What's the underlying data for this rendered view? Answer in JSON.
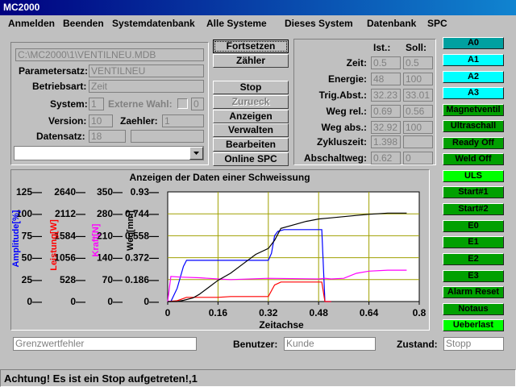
{
  "window": {
    "title": "MC2000"
  },
  "menu": [
    "Anmelden",
    "Beenden",
    "Systemdatenbank",
    "Alle Systeme",
    "Dieses System",
    "Datenbank",
    "SPC"
  ],
  "fileinfo": {
    "path": "C:\\MC2000\\1\\VENTILNEU.MDB",
    "parametersatz_label": "Parametersatz:",
    "parametersatz": "VENTILNEU",
    "betriebsart_label": "Betriebsart:",
    "betriebsart": "Zeit",
    "system_label": "System:",
    "system": "1",
    "extern_label": "Externe Wahl:",
    "extern_value": "0",
    "version_label": "Version:",
    "version": "10",
    "zaehler_label": "Zaehler:",
    "zaehler": "1",
    "datensatz_label": "Datensatz:",
    "datensatz": "18",
    "datensatz2": "",
    "combo": ""
  },
  "actions": {
    "fortsetzen": "Fortsetzen",
    "zaehler": "Zähler",
    "stop": "Stop",
    "zurueck": "Zurueck",
    "anzeigen": "Anzeigen",
    "verwalten": "Verwalten",
    "bearbeiten": "Bearbeiten",
    "online_spc": "Online SPC"
  },
  "values": {
    "ist_header": "Ist.:",
    "soll_header": "Soll:",
    "rows": [
      {
        "label": "Zeit:",
        "ist": "0.5",
        "soll": "0.5"
      },
      {
        "label": "Energie:",
        "ist": "48",
        "soll": "100"
      },
      {
        "label": "Trig.Abst.:",
        "ist": "32.23",
        "soll": "33.01"
      },
      {
        "label": "Weg rel.:",
        "ist": "0.69",
        "soll": "0.56"
      },
      {
        "label": "Weg abs.:",
        "ist": "32.92",
        "soll": "100"
      },
      {
        "label": "Zykluszeit:",
        "ist": "1.398",
        "soll": ""
      },
      {
        "label": "Abschaltweg:",
        "ist": "0.62",
        "soll": "0"
      }
    ]
  },
  "side_buttons": [
    {
      "label": "A0",
      "bg": "#00a0a0",
      "color": "#000000"
    },
    {
      "label": "A1",
      "bg": "#00ffff",
      "color": "#000000"
    },
    {
      "label": "A2",
      "bg": "#00ffff",
      "color": "#000000"
    },
    {
      "label": "A3",
      "bg": "#00ffff",
      "color": "#000000"
    },
    {
      "label": "Magnetventil",
      "bg": "#00a000",
      "color": "#000000"
    },
    {
      "label": "Ultraschall",
      "bg": "#00a000",
      "color": "#000000"
    },
    {
      "label": "Ready Off",
      "bg": "#00a000",
      "color": "#000000"
    },
    {
      "label": "Weld Off",
      "bg": "#00a000",
      "color": "#000000"
    },
    {
      "label": "ULS",
      "bg": "#00ff00",
      "color": "#000000"
    },
    {
      "label": "Start#1",
      "bg": "#00a000",
      "color": "#000000"
    },
    {
      "label": "Start#2",
      "bg": "#00a000",
      "color": "#000000"
    },
    {
      "label": "E0",
      "bg": "#00a000",
      "color": "#000000"
    },
    {
      "label": "E1",
      "bg": "#00a000",
      "color": "#000000"
    },
    {
      "label": "E2",
      "bg": "#00a000",
      "color": "#000000"
    },
    {
      "label": "E3",
      "bg": "#00a000",
      "color": "#000000"
    },
    {
      "label": "Alarm Reset",
      "bg": "#00a000",
      "color": "#000000"
    },
    {
      "label": "Notaus",
      "bg": "#00a000",
      "color": "#000000"
    },
    {
      "label": "Ueberlast",
      "bg": "#00ff00",
      "color": "#000000"
    }
  ],
  "chart_data": {
    "type": "line",
    "title": "Anzeigen der Daten einer Schweissung",
    "xlabel": "Zeitachse",
    "xlim": [
      0,
      0.8
    ],
    "xticks": [
      "0",
      "0.16",
      "0.32",
      "0.48",
      "0.64",
      "0.8"
    ],
    "grid": true,
    "axes": [
      {
        "label": "Amplitude[%]",
        "color": "#0000ff",
        "ticks": [
          "0",
          "25",
          "50",
          "75",
          "100",
          "125"
        ]
      },
      {
        "label": "Leistung[W]",
        "color": "#ff0000",
        "ticks": [
          "0",
          "528",
          "1056",
          "1584",
          "2112",
          "2640"
        ]
      },
      {
        "label": "Kraft[N]",
        "color": "#ff00ff",
        "ticks": [
          "0",
          "70",
          "140",
          "210",
          "280",
          "350"
        ]
      },
      {
        "label": "Weg[mm]",
        "color": "#000000",
        "ticks": [
          "0",
          "0.186",
          "0.372",
          "0.558",
          "0.744",
          "0.93"
        ]
      }
    ],
    "series": [
      {
        "color": "#0000ff",
        "x": [
          0,
          0.01,
          0.03,
          0.05,
          0.06,
          0.16,
          0.31,
          0.32,
          0.33,
          0.34,
          0.35,
          0.37,
          0.49,
          0.5,
          0.51,
          0.52
        ],
        "y": [
          0,
          0,
          15,
          40,
          47,
          47,
          47,
          47,
          55,
          75,
          80,
          82,
          82,
          0,
          0,
          0
        ]
      },
      {
        "color": "#ff0000",
        "x": [
          0,
          0.03,
          0.06,
          0.16,
          0.2,
          0.32,
          0.34,
          0.36,
          0.48,
          0.49,
          0.5,
          0.52
        ],
        "y": [
          0,
          20,
          100,
          100,
          120,
          120,
          400,
          470,
          470,
          470,
          0,
          0
        ]
      },
      {
        "color": "#ff00ff",
        "x": [
          0,
          0.01,
          0.04,
          0.1,
          0.16,
          0.2,
          0.32,
          0.48,
          0.5,
          0.52,
          0.56,
          0.6,
          0.64,
          0.7,
          0.76
        ],
        "y": [
          0,
          80,
          78,
          76,
          72,
          70,
          74,
          72,
          74,
          72,
          74,
          90,
          97,
          100,
          100
        ]
      },
      {
        "color": "#000000",
        "x": [
          0,
          0.01,
          0.03,
          0.05,
          0.08,
          0.1,
          0.13,
          0.16,
          0.2,
          0.24,
          0.28,
          0.32,
          0.34,
          0.36,
          0.4,
          0.44,
          0.48,
          0.52,
          0.56,
          0.6,
          0.64,
          0.7,
          0.76
        ],
        "y": [
          0,
          0,
          0,
          0.01,
          0.03,
          0.06,
          0.12,
          0.18,
          0.24,
          0.32,
          0.4,
          0.45,
          0.52,
          0.62,
          0.65,
          0.68,
          0.7,
          0.71,
          0.72,
          0.73,
          0.74,
          0.75,
          0.75
        ]
      }
    ]
  },
  "bottom": {
    "grenzwert": "Grenzwertfehler",
    "benutzer_label": "Benutzer:",
    "benutzer": "Kunde",
    "zustand_label": "Zustand:",
    "zustand": "Stopp"
  },
  "status": {
    "text": "Achtung! Es ist ein Stop aufgetreten!,1"
  }
}
